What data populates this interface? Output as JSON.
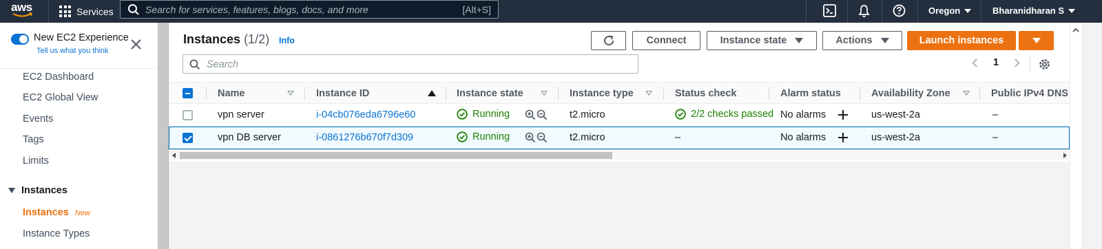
{
  "topnav": {
    "logo": "aws",
    "services": "Services",
    "search_placeholder": "Search for services, features, blogs, docs, and more",
    "search_shortcut": "[Alt+S]",
    "region": "Oregon",
    "user": "Bharanidharan S",
    "icons": [
      "cloudshell-icon",
      "bell-icon",
      "help-icon"
    ]
  },
  "sidebar": {
    "new_experience": "New EC2 Experience",
    "tell_us": "Tell us what you think",
    "items": [
      "EC2 Dashboard",
      "EC2 Global View",
      "Events",
      "Tags",
      "Limits"
    ],
    "section": "Instances",
    "active": "Instances",
    "active_badge": "New",
    "sub_item": "Instance Types"
  },
  "main": {
    "title": "Instances",
    "count": "(1/2)",
    "info": "Info",
    "buttons": {
      "connect": "Connect",
      "instance_state": "Instance state",
      "actions": "Actions",
      "launch": "Launch instances"
    },
    "search_placeholder": "Search",
    "page": "1",
    "columns": [
      "Name",
      "Instance ID",
      "Instance state",
      "Instance type",
      "Status check",
      "Alarm status",
      "Availability Zone",
      "Public IPv4 DNS"
    ],
    "rows": [
      {
        "selected": false,
        "name": "vpn server",
        "instance_id": "i-04cb076eda6796e60",
        "state": "Running",
        "type": "t2.micro",
        "status_check": "2/2 checks passed",
        "alarm": "No alarms",
        "az": "us-west-2a",
        "dns": "–"
      },
      {
        "selected": true,
        "name": "vpn DB server",
        "instance_id": "i-0861276b670f7d309",
        "state": "Running",
        "type": "t2.micro",
        "status_check": "–",
        "alarm": "No alarms",
        "az": "us-west-2a",
        "dns": "–"
      }
    ]
  },
  "colors": {
    "nav_bg": "#232f3e",
    "accent_orange": "#ec7211",
    "link_blue": "#0972d3",
    "success_green": "#1d8102"
  }
}
